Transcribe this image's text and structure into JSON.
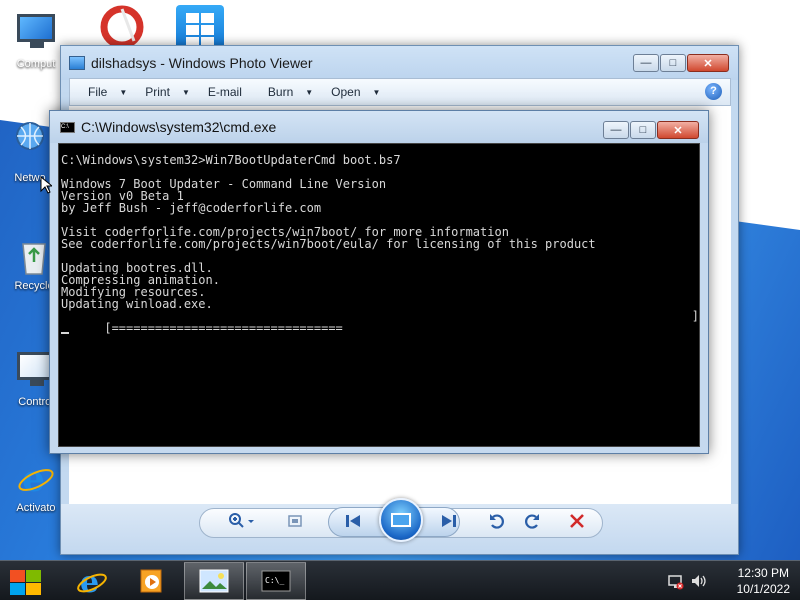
{
  "desktop": {
    "icons": [
      {
        "label": "Comput",
        "icon": "computer-icon"
      },
      {
        "label": "Netwo",
        "icon": "network-icon"
      },
      {
        "label": "Recycle",
        "icon": "recycle-bin-icon"
      },
      {
        "label": "Control",
        "icon": "control-panel-icon"
      },
      {
        "label": "Activato",
        "icon": "internet-explorer-icon"
      }
    ]
  },
  "photo_viewer": {
    "title": "dilshadsys - Windows Photo Viewer",
    "menu": {
      "file": "File",
      "print": "Print",
      "email": "E-mail",
      "burn": "Burn",
      "open": "Open"
    },
    "help": "?"
  },
  "cmd": {
    "title": "C:\\Windows\\system32\\cmd.exe",
    "lines": {
      "prompt": "C:\\Windows\\system32>Win7BootUpdaterCmd boot.bs7",
      "l1": "Windows 7 Boot Updater - Command Line Version",
      "l2": "Version v0 Beta 1",
      "l3": "by Jeff Bush - jeff@coderforlife.com",
      "l4": "Visit coderforlife.com/projects/win7boot/ for more information",
      "l5": "See coderforlife.com/projects/win7boot/eula/ for licensing of this product",
      "l6": "Updating bootres.dll.",
      "l7": "Compressing animation.",
      "l8": "Modifying resources.",
      "l9": "Updating winload.exe.",
      "progress": "[================================",
      "progress_end": "]"
    },
    "progress_fraction": 0.5
  },
  "taskbar": {
    "time": "12:30 PM",
    "date": "10/1/2022"
  },
  "colors": {
    "accent": "#2a78d6",
    "cmd_bg": "#000000",
    "cmd_text": "#d8d8d8"
  }
}
